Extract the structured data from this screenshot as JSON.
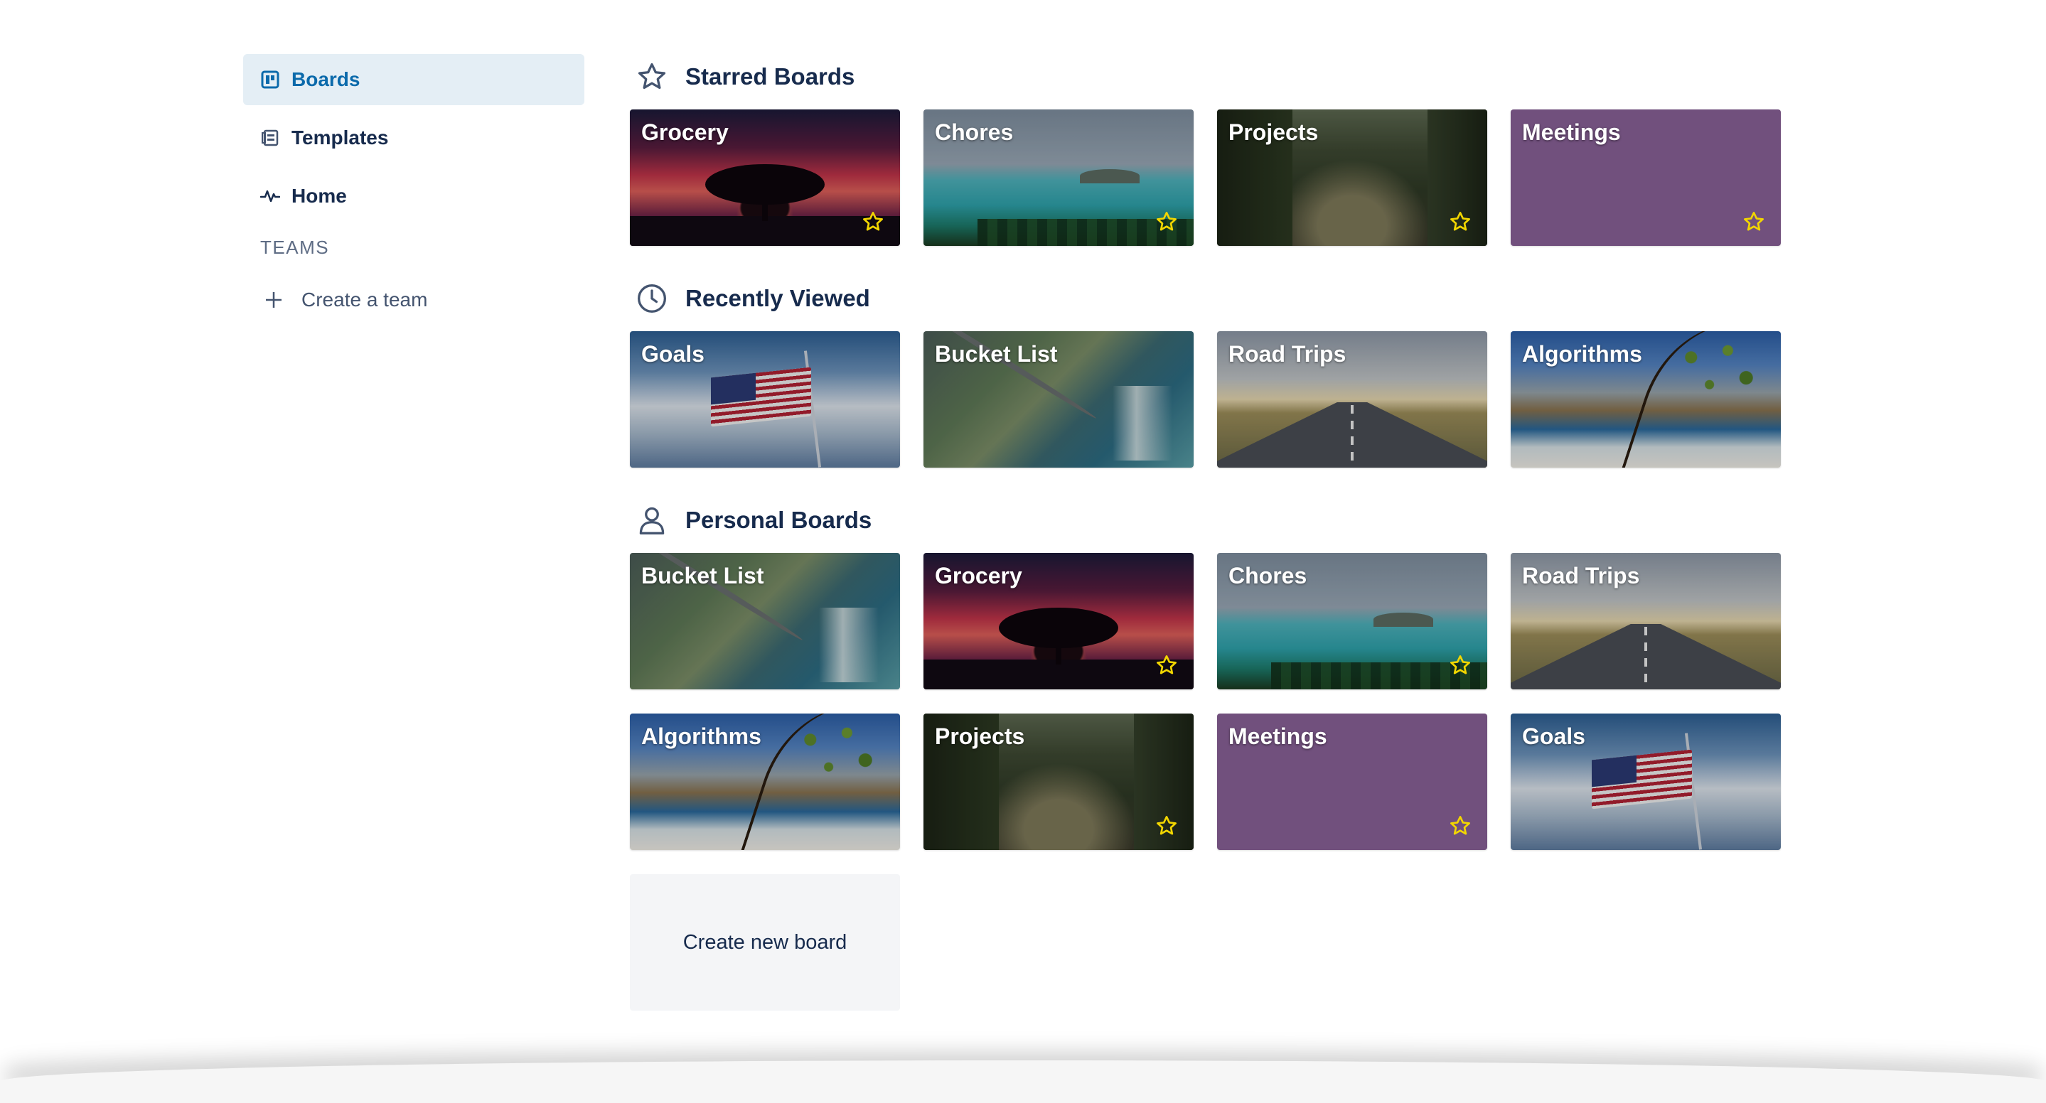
{
  "sidebar": {
    "items": [
      {
        "label": "Boards",
        "icon": "board-icon",
        "active": true
      },
      {
        "label": "Templates",
        "icon": "template-icon",
        "active": false
      },
      {
        "label": "Home",
        "icon": "activity-icon",
        "active": false
      }
    ],
    "teams_label": "TEAMS",
    "create_team_label": "Create a team"
  },
  "colors": {
    "accent": "#0b6aab",
    "active_bg": "#e4eef5",
    "star": "#f2d600",
    "meetings_bg": "#71507d"
  },
  "sections": {
    "starred": {
      "title": "Starred Boards",
      "icon": "star-outline-icon",
      "boards": [
        {
          "title": "Grocery",
          "bg": "grocery",
          "starred": true
        },
        {
          "title": "Chores",
          "bg": "chores",
          "starred": true
        },
        {
          "title": "Projects",
          "bg": "projects",
          "starred": true
        },
        {
          "title": "Meetings",
          "bg": "meetings",
          "starred": true
        }
      ]
    },
    "recent": {
      "title": "Recently Viewed",
      "icon": "clock-icon",
      "boards": [
        {
          "title": "Goals",
          "bg": "goals",
          "starred": false
        },
        {
          "title": "Bucket List",
          "bg": "bucket",
          "starred": false
        },
        {
          "title": "Road Trips",
          "bg": "road",
          "starred": false
        },
        {
          "title": "Algorithms",
          "bg": "algorithms",
          "starred": false
        }
      ]
    },
    "personal": {
      "title": "Personal Boards",
      "icon": "person-icon",
      "boards": [
        {
          "title": "Bucket List",
          "bg": "bucket",
          "starred": false
        },
        {
          "title": "Grocery",
          "bg": "grocery",
          "starred": true
        },
        {
          "title": "Chores",
          "bg": "chores",
          "starred": true
        },
        {
          "title": "Road Trips",
          "bg": "road",
          "starred": false
        },
        {
          "title": "Algorithms",
          "bg": "algorithms",
          "starred": false
        },
        {
          "title": "Projects",
          "bg": "projects",
          "starred": true
        },
        {
          "title": "Meetings",
          "bg": "meetings",
          "starred": true
        },
        {
          "title": "Goals",
          "bg": "goals",
          "starred": false
        }
      ],
      "create_board_label": "Create new board"
    }
  }
}
